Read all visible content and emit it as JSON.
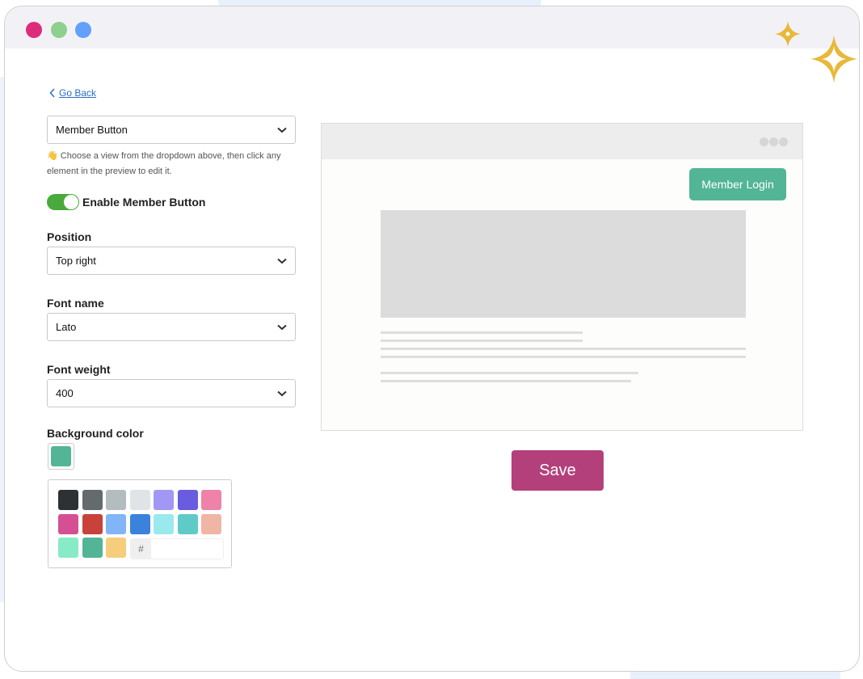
{
  "nav": {
    "go_back": "Go Back"
  },
  "view_select": {
    "value": "Member Button"
  },
  "help_text": "Choose a view from the dropdown above, then click any element in the preview to edit it.",
  "help_emoji": "👋",
  "toggle": {
    "label": "Enable Member Button",
    "on": true
  },
  "position": {
    "label": "Position",
    "value": "Top right"
  },
  "font_name": {
    "label": "Font name",
    "value": "Lato"
  },
  "font_weight": {
    "label": "Font weight",
    "value": "400"
  },
  "background_color": {
    "label": "Background color",
    "selected": "#52b595",
    "hex_prefix": "#",
    "hex_value": "",
    "swatches": [
      "#2d3134",
      "#646b6d",
      "#b3bcbe",
      "#e0e4e6",
      "#a198f5",
      "#6a5ce0",
      "#ee82a8",
      "#d64f93",
      "#c8413b",
      "#82b5f8",
      "#3a82dc",
      "#9ae9ec",
      "#5ecbc8",
      "#efb5a5",
      "#86ebc6",
      "#52b595",
      "#f5cd7b"
    ]
  },
  "preview": {
    "member_button_label": "Member Login"
  },
  "save_label": "Save",
  "colors": {
    "accent_save": "#b3407a",
    "toggle_on": "#49a93c",
    "link": "#2a6fc9",
    "sparkle": "#e9b83a",
    "window_dots": [
      "#de2c7c",
      "#8dd08f",
      "#62a0fa"
    ]
  }
}
